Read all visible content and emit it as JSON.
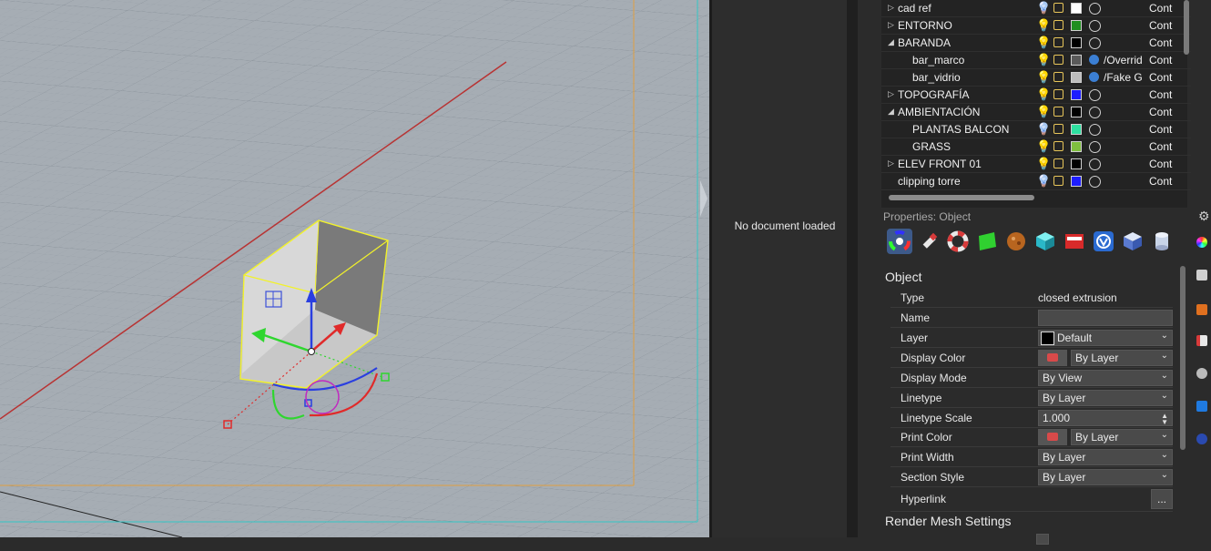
{
  "viewport": {
    "label": "Rhino viewport (perspective)"
  },
  "middle_panel": {
    "message": "No document loaded"
  },
  "layers": [
    {
      "name": "cad ref",
      "expand": "▷",
      "indent": 0,
      "bulb": "blue",
      "color": "#ffffff",
      "material": "",
      "linetype": "Cont"
    },
    {
      "name": "ENTORNO",
      "expand": "▷",
      "indent": 0,
      "bulb": "yellow",
      "color": "#1f8f1f",
      "material": "",
      "linetype": "Cont"
    },
    {
      "name": "BARANDA",
      "expand": "◢",
      "indent": 0,
      "bulb": "yellow",
      "color": "#000000",
      "material": "",
      "linetype": "Cont"
    },
    {
      "name": "bar_marco",
      "expand": "",
      "indent": 1,
      "bulb": "yellow",
      "color": "#5a5a5a",
      "material": "/Override",
      "linetype": "Cont"
    },
    {
      "name": "bar_vidrio",
      "expand": "",
      "indent": 1,
      "bulb": "yellow",
      "color": "#bdbdbd",
      "material": "/Fake Gla",
      "linetype": "Cont"
    },
    {
      "name": "TOPOGRAFÍA",
      "expand": "▷",
      "indent": 0,
      "bulb": "yellow",
      "color": "#1d1dff",
      "material": "",
      "linetype": "Cont"
    },
    {
      "name": "AMBIENTACIÓN",
      "expand": "◢",
      "indent": 0,
      "bulb": "yellow",
      "color": "#000000",
      "material": "",
      "linetype": "Cont"
    },
    {
      "name": "PLANTAS BALCON",
      "expand": "",
      "indent": 1,
      "bulb": "blue",
      "color": "#2ee0a0",
      "material": "",
      "linetype": "Cont"
    },
    {
      "name": "GRASS",
      "expand": "",
      "indent": 1,
      "bulb": "yellow",
      "color": "#7fbf3f",
      "material": "",
      "linetype": "Cont"
    },
    {
      "name": "ELEV FRONT 01",
      "expand": "▷",
      "indent": 0,
      "bulb": "yellow",
      "color": "#000000",
      "material": "",
      "linetype": "Cont"
    },
    {
      "name": "clipping torre",
      "expand": "",
      "indent": 0,
      "bulb": "blue",
      "color": "#1d1dff",
      "material": "",
      "linetype": "Cont"
    }
  ],
  "properties": {
    "title": "Properties: Object",
    "section_object": "Object",
    "section_render": "Render Mesh Settings",
    "rows": {
      "type_label": "Type",
      "type_value": "closed extrusion",
      "name_label": "Name",
      "name_value": "",
      "layer_label": "Layer",
      "layer_value": "Default",
      "display_color_label": "Display Color",
      "display_color_value": "By Layer",
      "display_mode_label": "Display Mode",
      "display_mode_value": "By View",
      "linetype_label": "Linetype",
      "linetype_value": "By Layer",
      "linetype_scale_label": "Linetype Scale",
      "linetype_scale_value": "1.000",
      "print_color_label": "Print Color",
      "print_color_value": "By Layer",
      "print_width_label": "Print Width",
      "print_width_value": "By Layer",
      "section_style_label": "Section Style",
      "section_style_value": "By Layer",
      "hyperlink_label": "Hyperlink",
      "hyperlink_button": "..."
    }
  },
  "tab_icons": [
    "color-wheel-icon",
    "paint-tool-icon",
    "lifesaver-icon",
    "green-sheet-icon",
    "texture-ball-icon",
    "cube-icon",
    "red-box-icon",
    "vray-icon",
    "blue-cube-icon",
    "cylinder-icon"
  ]
}
